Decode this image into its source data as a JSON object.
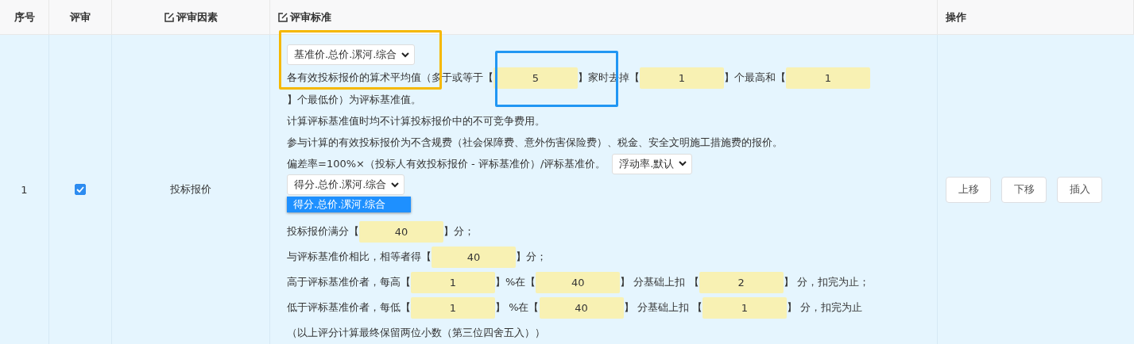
{
  "table": {
    "columns": [
      {
        "label": "序号",
        "editable": false
      },
      {
        "label": "评审",
        "editable": false
      },
      {
        "label": "评审因素",
        "editable": true
      },
      {
        "label": "评审标准",
        "editable": true
      },
      {
        "label": "操作",
        "editable": false
      }
    ],
    "rows": [
      {
        "index": "1",
        "checked": true,
        "factor": "投标报价",
        "criteria": [
          {
            "kind": "select",
            "value": "基准价.总价.漯河.综合"
          },
          {
            "kind": "line",
            "parts": [
              {
                "kind": "text",
                "text": "各有效投标报价的算术平均值（多于或等于【"
              },
              {
                "kind": "input",
                "value": "5"
              },
              {
                "kind": "text",
                "text": "】家时去掉【"
              },
              {
                "kind": "input",
                "value": "1"
              },
              {
                "kind": "text",
                "text": "】个最高和【"
              },
              {
                "kind": "input",
                "value": "1"
              },
              {
                "kind": "text",
                "text": "】个最低价）为评标基准值。"
              }
            ]
          },
          {
            "kind": "line",
            "parts": [
              {
                "kind": "text",
                "text": "计算评标基准值时均不计算投标报价中的不可竞争费用。"
              }
            ]
          },
          {
            "kind": "line",
            "parts": [
              {
                "kind": "text",
                "text": "参与计算的有效投标报价为不含规费（社会保障费、意外伤害保险费）、税金、安全文明施工措施费的报价。"
              }
            ]
          },
          {
            "kind": "line",
            "parts": [
              {
                "kind": "text",
                "text": "偏差率=100%×（投标人有效投标报价 - 评标基准价）/评标基准价。"
              },
              {
                "kind": "select",
                "value": "浮动率.默认"
              }
            ]
          },
          {
            "kind": "dropdown",
            "value": "得分.总价.漯河.综合",
            "options": [
              {
                "label": "得分.总价.漯河.综合",
                "selected": true
              }
            ]
          },
          {
            "kind": "line",
            "parts": [
              {
                "kind": "text",
                "text": "投标报价满分【"
              },
              {
                "kind": "input",
                "value": "40"
              },
              {
                "kind": "text",
                "text": "】分；"
              }
            ]
          },
          {
            "kind": "line",
            "parts": [
              {
                "kind": "text",
                "text": "与评标基准价相比，相等者得【"
              },
              {
                "kind": "input",
                "value": "40"
              },
              {
                "kind": "text",
                "text": "】分；"
              }
            ]
          },
          {
            "kind": "line",
            "parts": [
              {
                "kind": "text",
                "text": "高于评标基准价者，每高【"
              },
              {
                "kind": "input",
                "value": "1"
              },
              {
                "kind": "text",
                "text": "】%在【"
              },
              {
                "kind": "input",
                "value": "40"
              },
              {
                "kind": "text",
                "text": "】 分基础上扣 【"
              },
              {
                "kind": "input",
                "value": "2"
              },
              {
                "kind": "text",
                "text": "】 分，扣完为止；"
              }
            ]
          },
          {
            "kind": "line",
            "parts": [
              {
                "kind": "text",
                "text": "低于评标基准价者，每低【"
              },
              {
                "kind": "input",
                "value": "1"
              },
              {
                "kind": "text",
                "text": "】 %在【"
              },
              {
                "kind": "input",
                "value": "40"
              },
              {
                "kind": "text",
                "text": "】 分基础上扣 【"
              },
              {
                "kind": "input",
                "value": "1"
              },
              {
                "kind": "text",
                "text": "】 分，扣完为止"
              }
            ]
          },
          {
            "kind": "line",
            "parts": [
              {
                "kind": "text",
                "text": "（以上评分计算最终保留两位小数（第三位四舍五入））"
              }
            ]
          }
        ],
        "actions": [
          "上移",
          "下移",
          "插入"
        ]
      }
    ]
  },
  "highlights": [
    {
      "color": "#f5b800"
    },
    {
      "color": "#2196f3"
    }
  ]
}
